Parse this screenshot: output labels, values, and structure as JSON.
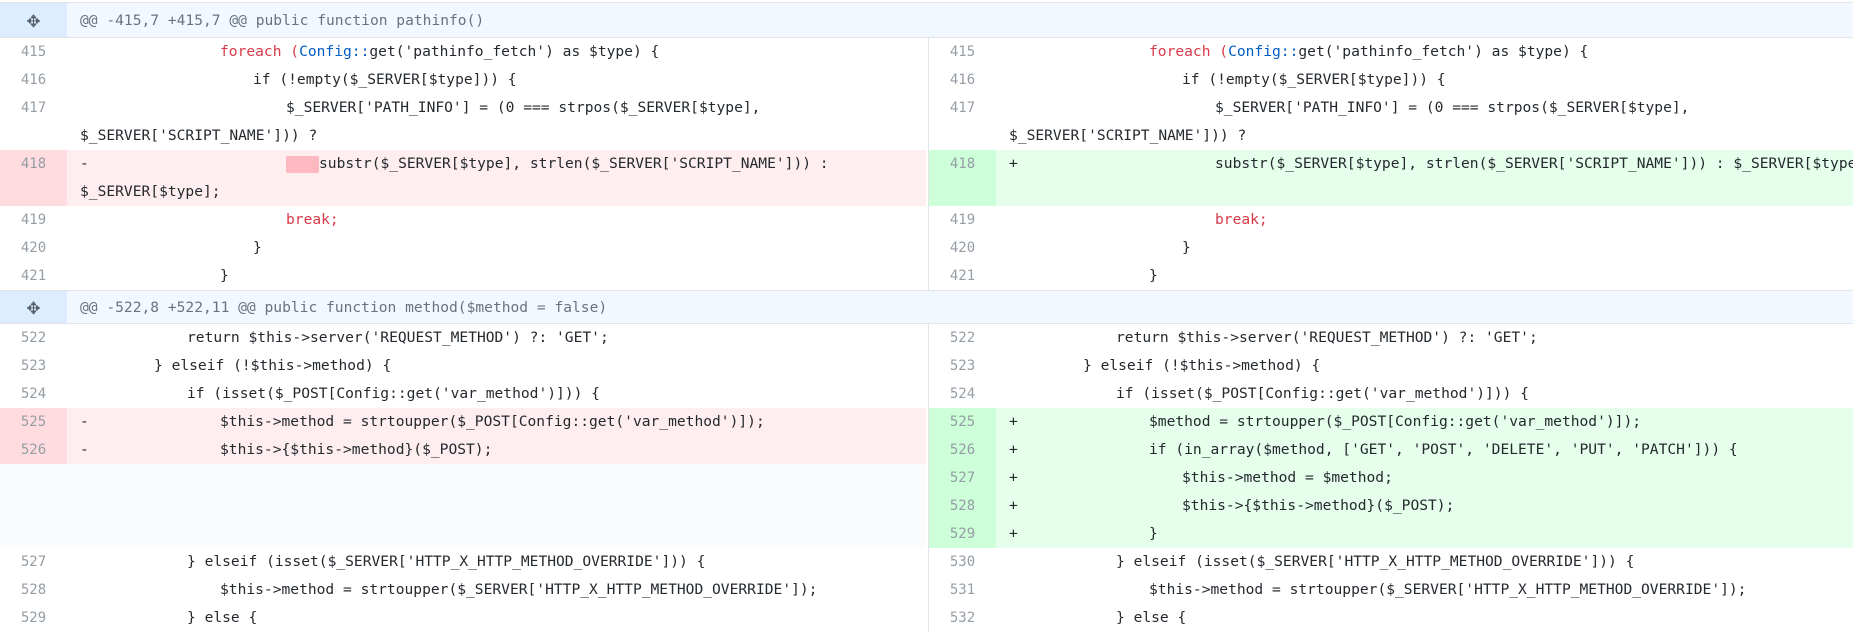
{
  "hunks": [
    "@@ -415,7 +415,7 @@ public function pathinfo()",
    "@@ -522,8 +522,11 @@ public function method($method = false)"
  ],
  "line_numbers": {
    "left": [
      "415",
      "416",
      "417",
      "418",
      "419",
      "420",
      "421",
      "522",
      "523",
      "524",
      "525",
      "526",
      "527",
      "528",
      "529"
    ],
    "right": [
      "415",
      "416",
      "417",
      "418",
      "419",
      "420",
      "421",
      "522",
      "523",
      "524",
      "525",
      "526",
      "527",
      "528",
      "529",
      "530",
      "531",
      "532"
    ]
  },
  "markers": {
    "del": "-",
    "add": "+"
  },
  "code": {
    "c415_1": "foreach (",
    "c415_2": "Config::",
    "c415_3": "get('pathinfo_fetch') as $type) {",
    "c416": "if (!empty($_SERVER[$type])) {",
    "c417a": "$_SERVER['PATH_INFO'] = (0 === strpos($_SERVER[$type],",
    "c417b": "$_SERVER['SCRIPT_NAME'])) ?",
    "c418_left_a": "substr($_SERVER[$type], strlen($_SERVER['SCRIPT_NAME'])) :",
    "c418_left_b": "$_SERVER[$type];",
    "c418_right": "substr($_SERVER[$type], strlen($_SERVER['SCRIPT_NAME'])) : $_SERVER[$type];",
    "c419": "break;",
    "c420": "}",
    "c421": "}",
    "c522": "return $this->server('REQUEST_METHOD') ?: 'GET';",
    "c523": "} elseif (!$this->method) {",
    "c524": "if (isset($_POST[Config::get('var_method')])) {",
    "c525_left": "$this->method = strtoupper($_POST[Config::get('var_method')]);",
    "c526_left": "$this->{$this->method}($_POST);",
    "c525_right": "$method = strtoupper($_POST[Config::get('var_method')]);",
    "c526_right": "if (in_array($method, ['GET', 'POST', 'DELETE', 'PUT', 'PATCH'])) {",
    "c527_right": "$this->method = $method;",
    "c528_right": "$this->{$this->method}($_POST);",
    "c529_right": "}",
    "c527": "} elseif (isset($_SERVER['HTTP_X_HTTP_METHOD_OVERRIDE'])) {",
    "c528": "$this->method = strtoupper($_SERVER['HTTP_X_HTTP_METHOD_OVERRIDE']);",
    "c529": "} else {"
  }
}
